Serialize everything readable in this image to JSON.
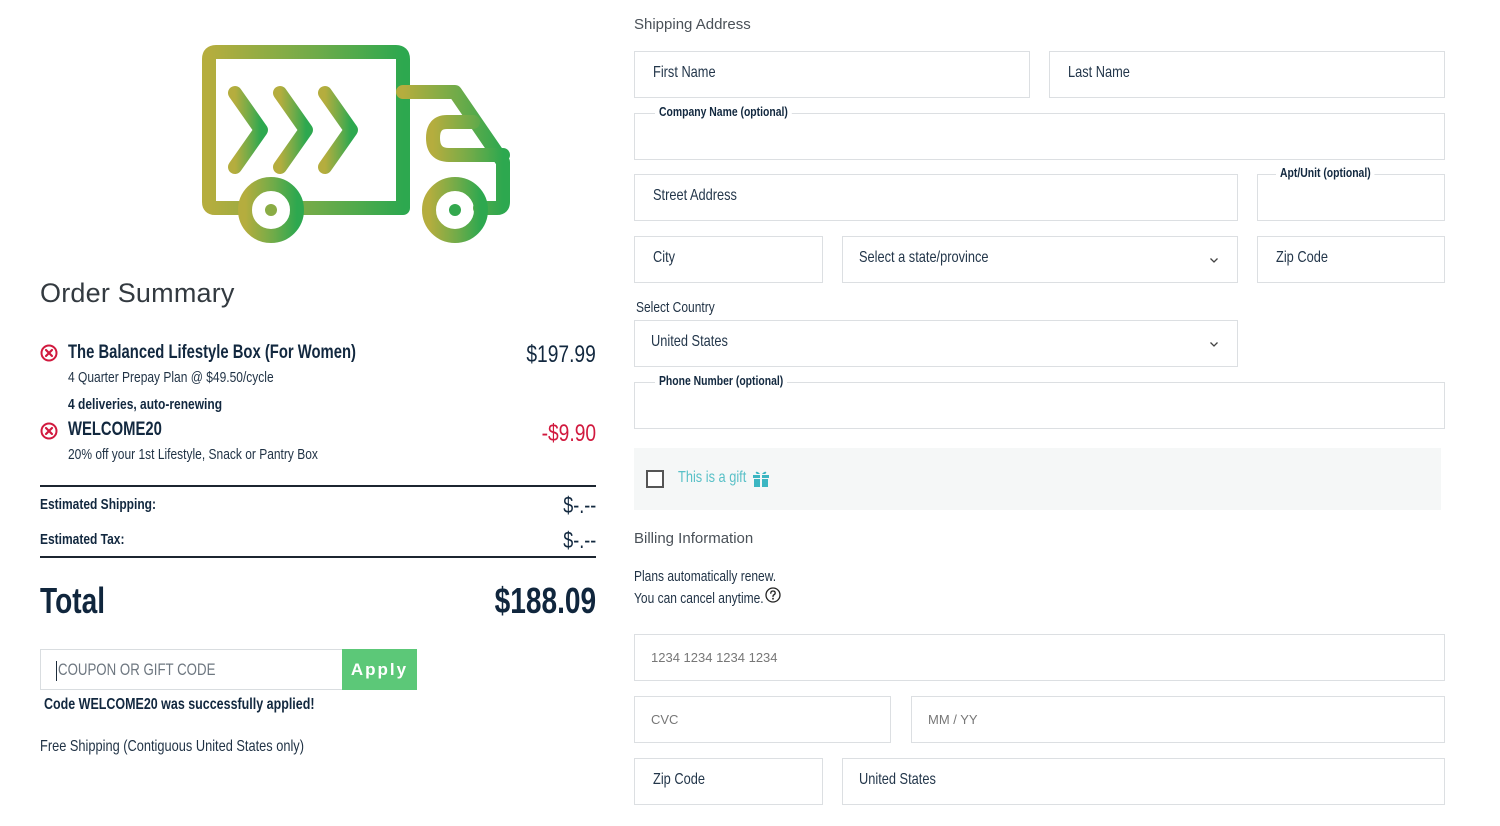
{
  "order_summary": {
    "title": "Order Summary",
    "items": [
      {
        "name": "The Balanced Lifestyle Box (For Women)",
        "details": [
          "4 Quarter Prepay Plan @ $49.50/cycle",
          "4 deliveries, auto-renewing"
        ],
        "price": "$197.99",
        "remove_icon": "remove-circle-x-icon"
      },
      {
        "name": "WELCOME20",
        "details": [
          "20% off your 1st Lifestyle, Snack or Pantry Box"
        ],
        "price": "-$9.90",
        "remove_icon": "remove-circle-x-icon"
      }
    ],
    "estimated_shipping_label": "Estimated Shipping:",
    "estimated_shipping_value": "$-.--",
    "estimated_tax_label": "Estimated Tax:",
    "estimated_tax_value": "$-.--",
    "total_label": "Total",
    "total_value": "$188.09",
    "coupon": {
      "placeholder": "COUPON OR GIFT CODE",
      "value": "",
      "apply_label": "Apply",
      "success_message": "Code WELCOME20 was successfully applied!"
    },
    "free_shipping_note": "Free Shipping (Contiguous United States only)",
    "colors": {
      "discount": "#d1193e",
      "apply_button": "#5cc878",
      "text_dark": "#12283f",
      "truck_gradient_start": "#b0ad3e",
      "truck_gradient_end": "#2fa84f"
    },
    "illustration": "delivery-truck-icon"
  },
  "shipping": {
    "title": "Shipping Address",
    "first_name": {
      "placeholder": "First Name",
      "value": ""
    },
    "last_name": {
      "placeholder": "Last Name",
      "value": ""
    },
    "company": {
      "label": "Company Name (optional)",
      "value": ""
    },
    "street": {
      "placeholder": "Street Address",
      "value": ""
    },
    "apt": {
      "label": "Apt/Unit (optional)",
      "value": ""
    },
    "city": {
      "placeholder": "City",
      "value": ""
    },
    "state": {
      "selected": "Select a state/province"
    },
    "zip": {
      "placeholder": "Zip Code",
      "value": ""
    },
    "country_label": "Select Country",
    "country": {
      "selected": "United States"
    },
    "phone": {
      "label": "Phone Number (optional)",
      "value": ""
    },
    "gift": {
      "label": "This is a gift",
      "checked": false,
      "icon": "gift-icon",
      "color": "#58c0c7"
    }
  },
  "billing": {
    "title": "Billing Information",
    "renew_line1": "Plans automatically renew.",
    "renew_line2": "You can cancel anytime.",
    "help_icon": "question-circle-icon",
    "card_number": {
      "placeholder": "1234 1234 1234 1234",
      "value": ""
    },
    "cvc": {
      "placeholder": "CVC",
      "value": ""
    },
    "expiry": {
      "placeholder": "MM / YY",
      "value": ""
    },
    "zip": {
      "placeholder": "Zip Code",
      "value": ""
    },
    "country": {
      "selected": "United States"
    }
  }
}
